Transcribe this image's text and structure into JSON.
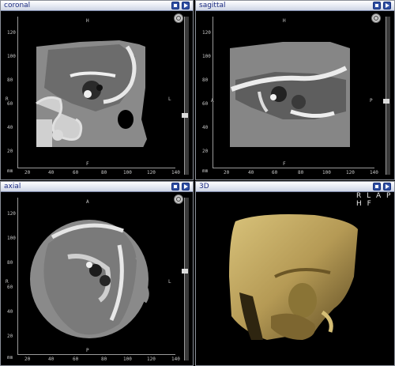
{
  "panes": {
    "coronal": {
      "title": "coronal",
      "top_label": "H",
      "bottom_label": "F",
      "left_label": "R",
      "right_label": "L",
      "unit": "mm",
      "y_ticks": [
        "120",
        "100",
        "80",
        "60",
        "40",
        "20"
      ],
      "x_ticks": [
        "20",
        "40",
        "60",
        "80",
        "100",
        "120",
        "140"
      ]
    },
    "sagittal": {
      "title": "sagittal",
      "top_label": "H",
      "bottom_label": "F",
      "left_label": "A",
      "right_label": "P",
      "unit": "mm",
      "y_ticks": [
        "120",
        "100",
        "80",
        "60",
        "40",
        "20"
      ],
      "x_ticks": [
        "20",
        "40",
        "60",
        "80",
        "100",
        "120",
        "140"
      ]
    },
    "axial": {
      "title": "axial",
      "top_label": "A",
      "bottom_label": "P",
      "left_label": "R",
      "right_label": "L",
      "unit": "mm",
      "y_ticks": [
        "120",
        "100",
        "80",
        "60",
        "40",
        "20"
      ],
      "x_ticks": [
        "20",
        "40",
        "60",
        "80",
        "100",
        "120",
        "140"
      ]
    },
    "volume": {
      "title": "3D",
      "orientation_labels": "R L A P H F"
    }
  },
  "colors": {
    "header_text": "#1a2a80",
    "button_blue": "#2f4fa3",
    "bone_gold": "#b59a55"
  },
  "icons": {
    "header_button_1": "stop-icon",
    "header_button_2": "play-icon",
    "reset_view": "target-icon",
    "slice_handle": "arrow-right-icon"
  }
}
